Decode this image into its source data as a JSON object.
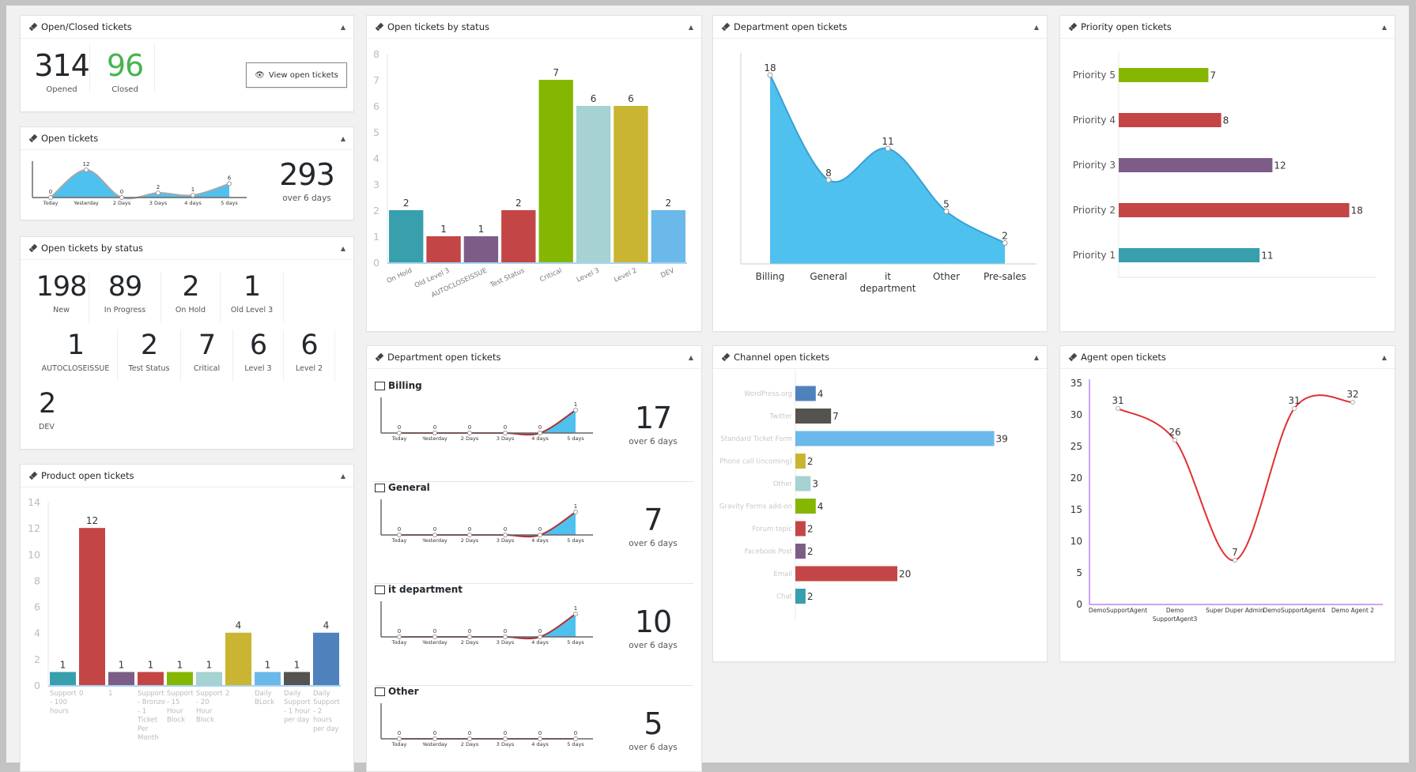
{
  "colors": {
    "teal": "#389fad",
    "red": "#c44545",
    "purple": "#7d5d88",
    "green": "#85b702",
    "lightteal": "#a6d2d1",
    "olive": "#c9b531",
    "lightblue": "#6bb9ea",
    "darkgray": "#555350",
    "blue": "#4f81bd",
    "area": "#4fc1ee",
    "agentline": "#e03030",
    "agentaxis": "#a040ff"
  },
  "open_closed": {
    "title": "Open/Closed tickets",
    "opened": "314",
    "opened_label": "Opened",
    "closed": "96",
    "closed_label": "Closed",
    "closed_color": "#46b450",
    "button": "View open tickets",
    "button_icon": "eye-icon"
  },
  "open_tickets": {
    "title": "Open tickets",
    "total": "293",
    "total_label": "over 6 days"
  },
  "status_counts": {
    "title": "Open tickets by status",
    "items": [
      {
        "n": "198",
        "l": "New"
      },
      {
        "n": "89",
        "l": "In Progress"
      },
      {
        "n": "2",
        "l": "On Hold"
      },
      {
        "n": "1",
        "l": "Old Level 3"
      },
      {
        "n": "1",
        "l": "AUTOCLOSEISSUE"
      },
      {
        "n": "2",
        "l": "Test Status"
      },
      {
        "n": "7",
        "l": "Critical"
      },
      {
        "n": "6",
        "l": "Level 3"
      },
      {
        "n": "6",
        "l": "Level 2"
      },
      {
        "n": "2",
        "l": "DEV"
      }
    ]
  },
  "product": {
    "title": "Product open tickets"
  },
  "status_chart": {
    "title": "Open tickets by status"
  },
  "dept_mini": {
    "title": "Department open tickets",
    "sections": [
      {
        "name": "Billing",
        "total": "17",
        "total_label": "over 6 days"
      },
      {
        "name": "General",
        "total": "7",
        "total_label": "over 6 days"
      },
      {
        "name": "it department",
        "total": "10",
        "total_label": "over 6 days"
      },
      {
        "name": "Other",
        "total": "5",
        "total_label": "over 6 days"
      }
    ]
  },
  "dept_chart": {
    "title": "Department open tickets"
  },
  "priority": {
    "title": "Priority open tickets"
  },
  "channel": {
    "title": "Channel open tickets"
  },
  "agent": {
    "title": "Agent open tickets"
  },
  "chart_data": [
    {
      "id": "open_tickets_trend",
      "type": "area",
      "categories": [
        "Today",
        "Yesterday",
        "2 Days",
        "3 Days",
        "4 days",
        "5 days"
      ],
      "values": [
        0,
        12,
        0,
        2,
        1,
        6
      ]
    },
    {
      "id": "status_chart",
      "type": "bar",
      "categories": [
        "On Hold",
        "Old Level 3",
        "AUTOCLOSEISSUE",
        "Test Status",
        "Critical",
        "Level 3",
        "Level 2",
        "DEV"
      ],
      "values": [
        2,
        1,
        1,
        2,
        7,
        6,
        6,
        2
      ],
      "colors": [
        "#389fad",
        "#c44545",
        "#7d5d88",
        "#c44545",
        "#85b702",
        "#a6d2d1",
        "#c9b531",
        "#6bb9ea"
      ],
      "ylim": [
        0,
        8
      ],
      "yticks": [
        0,
        1,
        2,
        3,
        4,
        5,
        6,
        7,
        8
      ],
      "grid": false
    },
    {
      "id": "product",
      "type": "bar",
      "categories": [
        "Support - 100 hours",
        "0",
        "1",
        "Support - Bronze - 1 Ticket Per Month",
        "Support - 15 Hour Block",
        "Support - 20 Hour Block",
        "2",
        "Daily BLock",
        "Daily Support - 1 hour per day",
        "Daily Support - 2 hours per day"
      ],
      "values": [
        1,
        12,
        1,
        1,
        1,
        1,
        4,
        1,
        1,
        4
      ],
      "colors": [
        "#389fad",
        "#c44545",
        "#7d5d88",
        "#c44545",
        "#85b702",
        "#a6d2d1",
        "#c9b531",
        "#6bb9ea",
        "#555350",
        "#4f81bd"
      ],
      "ylim": [
        0,
        14
      ],
      "yticks": [
        0,
        2,
        4,
        6,
        8,
        10,
        12,
        14
      ],
      "grid": false
    },
    {
      "id": "dept_chart",
      "type": "area",
      "categories": [
        "Billing",
        "General",
        "it department",
        "Other",
        "Pre-sales"
      ],
      "values": [
        18,
        8,
        11,
        5,
        2
      ],
      "ylim": [
        0,
        18
      ]
    },
    {
      "id": "priority",
      "type": "bar",
      "orientation": "horizontal",
      "categories": [
        "Priority 5",
        "Priority 4",
        "Priority 3",
        "Priority 2",
        "Priority 1"
      ],
      "values": [
        7,
        8,
        12,
        18,
        11
      ],
      "colors": [
        "#85b702",
        "#c44545",
        "#7d5d88",
        "#c44545",
        "#389fad"
      ]
    },
    {
      "id": "channel",
      "type": "bar",
      "orientation": "horizontal",
      "categories": [
        "WordPress.org",
        "Twitter",
        "Standard Ticket Form",
        "Phone call (incoming)",
        "Other",
        "Gravity Forms add-on",
        "Forum topic",
        "Facebook Post",
        "Email",
        "Chat"
      ],
      "values": [
        4,
        7,
        39,
        2,
        3,
        4,
        2,
        2,
        20,
        2
      ],
      "colors": [
        "#4f81bd",
        "#555350",
        "#6bb9ea",
        "#c9b531",
        "#a6d2d1",
        "#85b702",
        "#c44545",
        "#7d5d88",
        "#c44545",
        "#389fad"
      ]
    },
    {
      "id": "agent",
      "type": "line",
      "categories": [
        "DemoSupportAgent",
        "Demo SupportAgent3",
        "Super Duper Admin",
        "DemoSupportAgent4",
        "Demo Agent 2"
      ],
      "values": [
        31,
        26,
        7,
        31,
        32
      ],
      "ylim": [
        0,
        35
      ],
      "yticks": [
        0,
        5,
        10,
        15,
        20,
        25,
        30,
        35
      ]
    },
    {
      "id": "mini_0",
      "type": "area",
      "categories": [
        "Today",
        "Yesterday",
        "2 Days",
        "3 Days",
        "4 days",
        "5 days"
      ],
      "values": [
        0,
        0,
        0,
        0,
        0,
        1
      ]
    },
    {
      "id": "mini_1",
      "type": "area",
      "categories": [
        "Today",
        "Yesterday",
        "2 Days",
        "3 Days",
        "4 days",
        "5 days"
      ],
      "values": [
        0,
        0,
        0,
        0,
        0,
        1
      ]
    },
    {
      "id": "mini_2",
      "type": "area",
      "categories": [
        "Today",
        "Yesterday",
        "2 Days",
        "3 Days",
        "4 days",
        "5 days"
      ],
      "values": [
        0,
        0,
        0,
        0,
        0,
        1
      ]
    },
    {
      "id": "mini_3",
      "type": "area",
      "categories": [
        "Today",
        "Yesterday",
        "2 Days",
        "3 Days",
        "4 days",
        "5 days"
      ],
      "values": [
        0,
        0,
        0,
        0,
        0,
        0
      ]
    }
  ]
}
